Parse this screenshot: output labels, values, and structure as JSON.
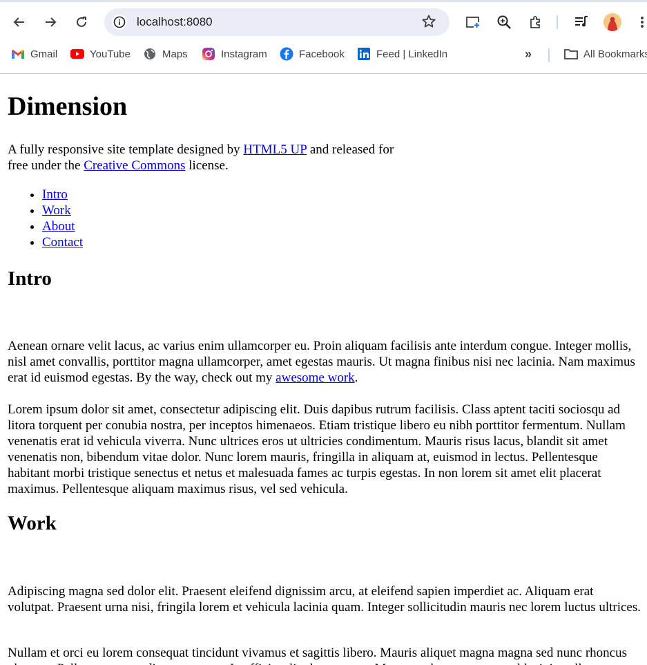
{
  "browser": {
    "url": "localhost:8080",
    "bookmarks": [
      {
        "label": "Gmail",
        "icon": "gmail-icon"
      },
      {
        "label": "YouTube",
        "icon": "youtube-icon"
      },
      {
        "label": "Maps",
        "icon": "maps-icon"
      },
      {
        "label": "Instagram",
        "icon": "instagram-icon"
      },
      {
        "label": "Facebook",
        "icon": "facebook-icon"
      },
      {
        "label": "Feed | LinkedIn",
        "icon": "linkedin-icon"
      }
    ],
    "more_bookmarks": "»",
    "all_bookmarks": "All Bookmarks"
  },
  "page": {
    "title": "Dimension",
    "intro_prefix": "A fully responsive site template designed by ",
    "intro_link1": "HTML5 UP",
    "intro_middle": " and released for free under the ",
    "intro_link2": "Creative Commons",
    "intro_suffix": " license.",
    "nav": [
      "Intro",
      "Work",
      "About",
      "Contact"
    ],
    "sections": [
      {
        "heading": "Intro",
        "p1_text": "Aenean ornare velit lacus, ac varius enim ullamcorper eu. Proin aliquam facilisis ante interdum congue. Integer mollis, nisl amet convallis, porttitor magna ullamcorper, amet egestas mauris. Ut magna finibus nisi nec lacinia. Nam maximus erat id euismod egestas. By the way, check out my ",
        "p1_link": "awesome work",
        "p1_end": ".",
        "p2": "Lorem ipsum dolor sit amet, consectetur adipiscing elit. Duis dapibus rutrum facilisis. Class aptent taciti sociosqu ad litora torquent per conubia nostra, per inceptos himenaeos. Etiam tristique libero eu nibh porttitor fermentum. Nullam venenatis erat id vehicula viverra. Nunc ultrices eros ut ultricies condimentum. Mauris risus lacus, blandit sit amet venenatis non, bibendum vitae dolor. Nunc lorem mauris, fringilla in aliquam at, euismod in lectus. Pellentesque habitant morbi tristique senectus et netus et malesuada fames ac turpis egestas. In non lorem sit amet elit placerat maximus. Pellentesque aliquam maximus risus, vel sed vehicula."
      },
      {
        "heading": "Work",
        "p1": "Adipiscing magna sed dolor elit. Praesent eleifend dignissim arcu, at eleifend sapien imperdiet ac. Aliquam erat volutpat. Praesent urna nisi, fringila lorem et vehicula lacinia quam. Integer sollicitudin mauris nec lorem luctus ultrices.",
        "p2": "Nullam et orci eu lorem consequat tincidunt vivamus et sagittis libero. Mauris aliquet magna magna sed nunc rhoncus pharetra. Pellentesque condimentum sem. In efficitur ligula tate urna. Maecenas laoreet massa vel lacinia pellentesque lorem ipsum dolor."
      }
    ]
  }
}
